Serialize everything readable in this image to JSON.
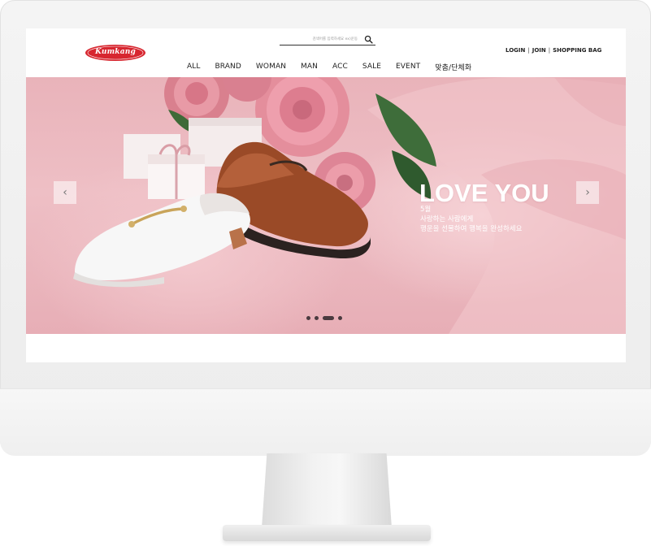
{
  "header": {
    "logo_text": "Kumkang",
    "search_placeholder": "검색어를 입력하세요 ex)운동",
    "util_links": [
      "LOGIN",
      "JOIN",
      "SHOPPING BAG"
    ],
    "util_separator": "|"
  },
  "nav": {
    "items": [
      "ALL",
      "BRAND",
      "WOMAN",
      "MAN",
      "ACC",
      "SALE",
      "EVENT",
      "맞춤/단체화"
    ]
  },
  "hero": {
    "title": "LOVE YOU",
    "sub_line1": "5월",
    "sub_line2": "사랑하는 사람에게",
    "sub_line3": "행운을 선물하여 행복을 완성하세요",
    "prev_label": "‹",
    "next_label": "›",
    "slide_count": 4,
    "active_slide_index": 2
  },
  "colors": {
    "logo_red": "#d7262f",
    "hero_pink": "#eebfc5",
    "text_dark": "#222222"
  }
}
